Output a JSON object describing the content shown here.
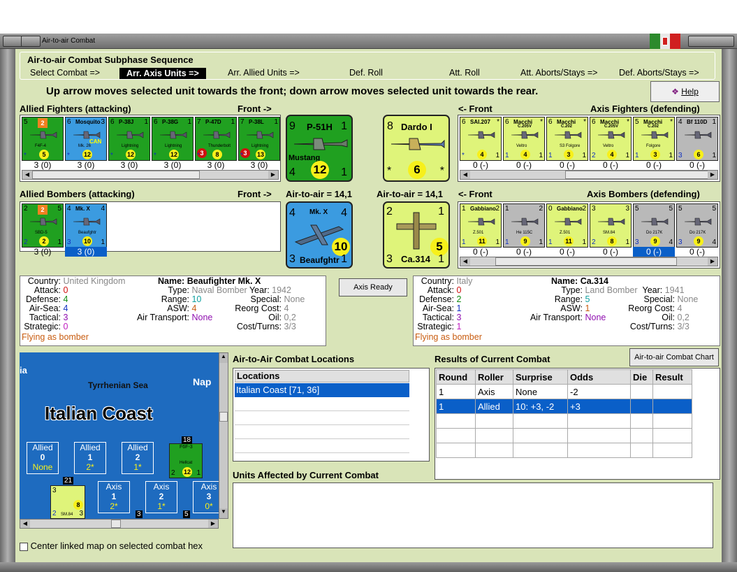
{
  "window": {
    "title": "Air-to-air Combat",
    "flag_colors": [
      "#2c8a2c",
      "#e8e8e8",
      "#d02020"
    ]
  },
  "sequence": {
    "title": "Air-to-air Combat Subphase Sequence",
    "steps": [
      "Select Combat =>",
      "Arr. Axis Units =>",
      "Arr. Allied Units =>",
      "Def. Roll",
      "Att. Roll",
      "Att. Aborts/Stays =>",
      "Def. Aborts/Stays =>"
    ],
    "active_index": 1
  },
  "instruction": "Up arrow moves selected unit towards the front; down arrow moves selected unit towards the rear.",
  "help_button": "Help",
  "allied_fighters": {
    "title": "Allied Fighters (attacking)",
    "front": "Front ->",
    "units": [
      {
        "name": "",
        "atk": "5",
        "def": "",
        "badge": "2",
        "stat": "5",
        "bl": "*",
        "sub": "F4F-4",
        "color": "grn",
        "label": "3 (0)"
      },
      {
        "name": "Mosquito",
        "atk": "6",
        "def": "3",
        "badge": "",
        "stat": "12",
        "bl": "*",
        "sub": "Mk. 26",
        "extra": "CAN",
        "color": "blu",
        "label": "3 (0)"
      },
      {
        "name": "P-38J",
        "atk": "6",
        "def": "1",
        "badge": "",
        "stat": "12",
        "bl": "*",
        "sub": "Lightning",
        "color": "grn",
        "label": "3 (0)"
      },
      {
        "name": "P-38G",
        "atk": "6",
        "def": "1",
        "badge": "",
        "stat": "12",
        "bl": "*",
        "sub": "Lightning",
        "color": "grn",
        "label": "3 (0)"
      },
      {
        "name": "P-47D",
        "atk": "7",
        "def": "1",
        "badge": "3",
        "stat": "8",
        "bl": "*",
        "sub": "Thunderbolt",
        "color": "grn",
        "label": "3 (0)"
      },
      {
        "name": "P-38L",
        "atk": "7",
        "def": "1",
        "badge": "3",
        "stat": "13",
        "bl": "*",
        "sub": "Lightning",
        "color": "grn",
        "label": "3 (0)"
      }
    ]
  },
  "axis_fighters": {
    "title": "Axis Fighters (defending)",
    "front": "<- Front",
    "units": [
      {
        "name": "SAI.207",
        "atk": "6",
        "def": "*",
        "stat": "4",
        "bl": "*",
        "br": "1",
        "color": "lgr",
        "label": "0 (-)"
      },
      {
        "name": "Macchi",
        "name2": "C.205V",
        "atk": "6",
        "def": "*",
        "stat": "4",
        "bl": "1",
        "br": "1",
        "sub": "Veltro",
        "color": "lgr",
        "label": "0 (-)"
      },
      {
        "name": "Macchi",
        "name2": "C.202",
        "atk": "6",
        "def": "*",
        "stat": "3",
        "bl": "1",
        "br": "1",
        "sub": "S3 Folgore",
        "color": "lgr",
        "label": "0 (-)"
      },
      {
        "name": "Macchi",
        "name2": "C.205V",
        "atk": "6",
        "def": "*",
        "stat": "4",
        "bl": "2",
        "br": "1",
        "sub": "Veltro",
        "color": "lgr",
        "label": "0 (-)"
      },
      {
        "name": "Macchi",
        "name2": "C.202",
        "atk": "5",
        "def": "*",
        "stat": "3",
        "bl": "1",
        "br": "1",
        "sub": "Folgore",
        "color": "lgr",
        "label": "0 (-)"
      },
      {
        "name": "Bf 110D",
        "atk": "4",
        "def": "1",
        "stat": "6",
        "bl": "3",
        "br": "1",
        "color": "gry",
        "label": "0 (-)"
      }
    ]
  },
  "allied_bombers": {
    "title": "Allied Bombers (attacking)",
    "front": "Front ->",
    "units": [
      {
        "name": "",
        "atk": "2",
        "def": "5",
        "badge": "2",
        "stat": "2",
        "bl": "2",
        "br": "1",
        "sub": "SBD-5",
        "color": "grn",
        "label": "3 (0)"
      },
      {
        "name": "Mk. X",
        "atk": "4",
        "def": "4",
        "stat": "10",
        "bl": "3",
        "br": "1",
        "sub": "Beaufghtr",
        "color": "blu",
        "label": "3 (0)",
        "selected": true
      }
    ]
  },
  "axis_bombers": {
    "title": "Axis Bombers (defending)",
    "front": "<- Front",
    "units": [
      {
        "name": "Gabbiano",
        "atk": "1",
        "def": "2",
        "stat": "11",
        "bl": "1",
        "br": "1",
        "sub": "Z.501",
        "color": "lgr",
        "label": "0 (-)"
      },
      {
        "name": "",
        "atk": "1",
        "def": "2",
        "stat": "9",
        "bl": "1",
        "br": "1",
        "sub": "He 115C",
        "color": "gry",
        "label": "0 (-)"
      },
      {
        "name": "Gabbiano",
        "atk": "0",
        "def": "2",
        "stat": "11",
        "bl": "1",
        "br": "1",
        "sub": "Z.501",
        "color": "lgr",
        "label": "0 (-)"
      },
      {
        "name": "",
        "atk": "3",
        "def": "3",
        "stat": "8",
        "bl": "2",
        "br": "1",
        "sub": "SM.84",
        "color": "lgr",
        "label": "0 (-)"
      },
      {
        "name": "",
        "atk": "5",
        "def": "5",
        "stat": "9",
        "bl": "3",
        "br": "4",
        "sub": "Do 217K",
        "color": "gry",
        "label": "0 (-)",
        "selected": true
      },
      {
        "name": "",
        "atk": "5",
        "def": "5",
        "stat": "9",
        "bl": "3",
        "br": "4",
        "sub": "Do 217K",
        "color": "gry",
        "label": "0 (-)"
      }
    ]
  },
  "big_counters": {
    "allied_fighter": {
      "name": "P-51H",
      "atk": "9",
      "def": "1",
      "sub": "Mustang",
      "stat": "12",
      "bl": "4",
      "br": "1"
    },
    "axis_fighter": {
      "name": "Dardo I",
      "atk": "8",
      "stat": "6",
      "bl": "*",
      "br": "*"
    },
    "allied_bomber": {
      "name": "Mk. X",
      "atk": "4",
      "def": "4",
      "sub": "Beaufghtr",
      "stat": "10",
      "bl": "3",
      "br": "1"
    },
    "axis_bomber": {
      "name": "Ca.314",
      "atk": "2",
      "def": "1",
      "stat": "5",
      "bl": "3",
      "br": "1"
    }
  },
  "air_to_air_left": "Air-to-air = 14,1",
  "air_to_air_right": "Air-to-air = 14,1",
  "axis_ready_button": "Axis Ready",
  "allied_info": {
    "country": "United Kingdom",
    "attack": "0",
    "defense": "4",
    "airsea": "4",
    "tactical": "3",
    "strategic": "0",
    "status": "Flying as bomber",
    "name": "Beaufighter Mk. X",
    "type": "Naval Bomber",
    "year": "1942",
    "range": "10",
    "special": "None",
    "asw": "4",
    "reorg": "4",
    "airtransport": "None",
    "oil": "0,2",
    "costturns": "3/3"
  },
  "axis_info": {
    "country": "Italy",
    "attack": "0",
    "defense": "2",
    "airsea": "1",
    "tactical": "3",
    "strategic": "1",
    "status": "Flying as bomber",
    "name": "Ca.314",
    "type": "Land Bomber",
    "year": "1941",
    "range": "5",
    "special": "None",
    "asw": "1",
    "reorg": "4",
    "airtransport": "None",
    "oil": "0,2",
    "costturns": "3/3"
  },
  "labels": {
    "country": "Country:",
    "attack": "Attack:",
    "defense": "Defense:",
    "airsea": "Air-Sea:",
    "tactical": "Tactical:",
    "strategic": "Strategic:",
    "name": "Name:",
    "type": "Type:",
    "year": "Year:",
    "range": "Range:",
    "special": "Special:",
    "asw": "ASW:",
    "reorg": "Reorg Cost:",
    "airtransport": "Air Transport:",
    "oil": "Oil:",
    "costturns": "Cost/Turns:"
  },
  "map": {
    "title_fragment": "ia",
    "sea": "Tyrrhenian Sea",
    "nap": "Nap",
    "region": "Italian Coast",
    "allied_boxes": [
      {
        "label": "Allied",
        "num": "0",
        "sub": "None"
      },
      {
        "label": "Allied",
        "num": "1",
        "sub": "2*"
      },
      {
        "label": "Allied",
        "num": "2",
        "sub": "1*"
      }
    ],
    "axis_boxes": [
      {
        "label": "Axis",
        "num": "1",
        "sub": "2*"
      },
      {
        "label": "Axis",
        "num": "2",
        "sub": "1*"
      },
      {
        "label": "Axis",
        "num": "3",
        "sub": "0*"
      }
    ],
    "counter_f6f": {
      "name": "F6F-3",
      "sub": "Hellcat",
      "stat": "12",
      "top": "18",
      "bl": "2",
      "br": "1"
    },
    "counter_sm84": {
      "top": "21",
      "atk": "3",
      "stat": "8",
      "sub": "SM.84",
      "bl": "2",
      "br": "3"
    },
    "stack3": "3",
    "stack5": "5"
  },
  "center_checkbox": "Center linked map on selected combat hex",
  "locations": {
    "title": "Air-to-Air Combat Locations",
    "header": "Locations",
    "items": [
      "Italian Coast [71, 36]"
    ]
  },
  "chart_button": "Air-to-air Combat Chart",
  "results": {
    "title": "Results of Current Combat",
    "columns": [
      "Round",
      "Roller",
      "Surprise",
      "Odds",
      "Die",
      "Result"
    ],
    "rows": [
      [
        "1",
        "Axis",
        "None",
        "-2",
        "",
        ""
      ],
      [
        "1",
        "Allied",
        "10: +3, -2",
        "+3",
        "",
        ""
      ]
    ]
  },
  "affected": {
    "title": "Units Affected by Current Combat"
  }
}
